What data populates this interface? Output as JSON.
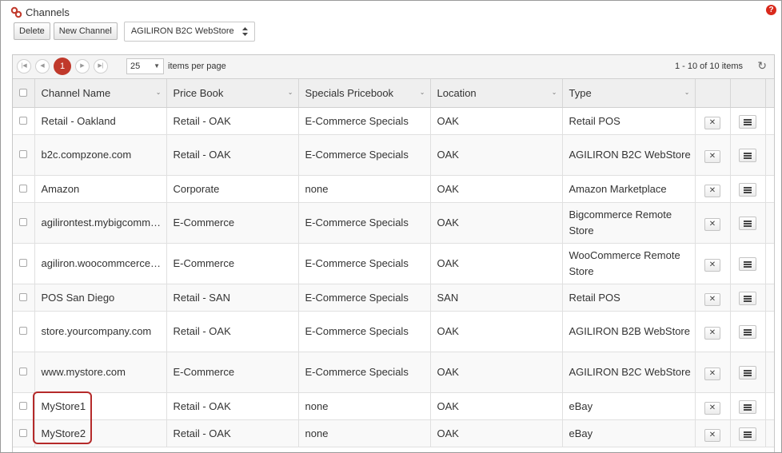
{
  "header": {
    "title": "Channels",
    "help": "?"
  },
  "toolbar": {
    "delete_label": "Delete",
    "new_label": "New Channel",
    "store_select": "AGILIRON B2C WebStore"
  },
  "pager": {
    "first": "|◀",
    "prev": "◀",
    "current_page": "1",
    "next": "▶",
    "last": "▶|",
    "page_size": "25",
    "items_per_page_label": "items per page",
    "range_info": "1 - 10 of 10 items",
    "refresh": "↻"
  },
  "columns": [
    "Channel Name",
    "Price Book",
    "Specials Pricebook",
    "Location",
    "Type"
  ],
  "rows": [
    {
      "name": "Retail - Oakland",
      "price_book": "Retail - OAK",
      "specials": "E-Commerce Specials",
      "location": "OAK",
      "type": "Retail POS"
    },
    {
      "name": "b2c.compzone.com",
      "price_book": "Retail - OAK",
      "specials": "E-Commerce Specials",
      "location": "OAK",
      "type": "AGILIRON B2C WebStore"
    },
    {
      "name": "Amazon",
      "price_book": "Corporate",
      "specials": "none",
      "location": "OAK",
      "type": "Amazon Marketplace"
    },
    {
      "name": "agilirontest.mybigcomm…",
      "price_book": "E-Commerce",
      "specials": "E-Commerce Specials",
      "location": "OAK",
      "type": "Bigcommerce Remote Store"
    },
    {
      "name": "agiliron.woocommcerce…",
      "price_book": "E-Commerce",
      "specials": "E-Commerce Specials",
      "location": "OAK",
      "type": "WooCommerce Remote Store"
    },
    {
      "name": "POS San Diego",
      "price_book": "Retail - SAN",
      "specials": "E-Commerce Specials",
      "location": "SAN",
      "type": "Retail POS"
    },
    {
      "name": "store.yourcompany.com",
      "price_book": "Retail - OAK",
      "specials": "E-Commerce Specials",
      "location": "OAK",
      "type": "AGILIRON B2B WebStore"
    },
    {
      "name": "www.mystore.com",
      "price_book": "E-Commerce",
      "specials": "E-Commerce Specials",
      "location": "OAK",
      "type": "AGILIRON B2C WebStore"
    },
    {
      "name": "MyStore1",
      "price_book": "Retail - OAK",
      "specials": "none",
      "location": "OAK",
      "type": "eBay"
    },
    {
      "name": "MyStore2",
      "price_book": "Retail - OAK",
      "specials": "none",
      "location": "OAK",
      "type": "eBay"
    }
  ],
  "row_actions": {
    "delete_glyph": "✕"
  },
  "colors": {
    "accent": "#c0392b",
    "highlight_border": "#b52a2a"
  }
}
